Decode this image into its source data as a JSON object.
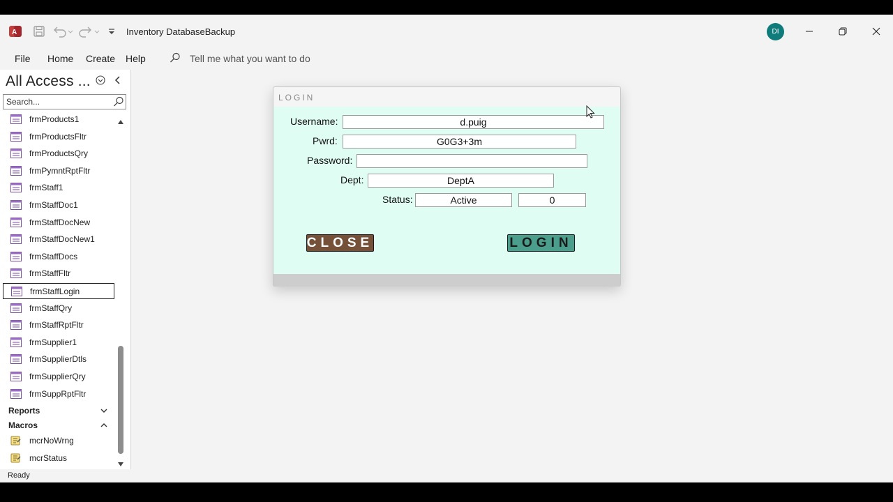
{
  "window": {
    "title": "Inventory DatabaseBackup",
    "avatar_initials": "DI",
    "accent": "#0f7b7b",
    "app_brand_color": "#c43e3e"
  },
  "menu": {
    "file": "File",
    "home": "Home",
    "create": "Create",
    "help": "Help",
    "tell_me": "Tell me what you want to do"
  },
  "nav": {
    "title": "All Access ...",
    "search_placeholder": "Search...",
    "items": [
      {
        "label": "frmProducts1",
        "icon": "form-icon"
      },
      {
        "label": "frmProductsFltr",
        "icon": "form-icon"
      },
      {
        "label": "frmProductsQry",
        "icon": "form-icon"
      },
      {
        "label": "frmPymntRptFltr",
        "icon": "form-icon"
      },
      {
        "label": "frmStaff1",
        "icon": "form-icon"
      },
      {
        "label": "frmStaffDoc1",
        "icon": "form-icon"
      },
      {
        "label": "frmStaffDocNew",
        "icon": "form-icon"
      },
      {
        "label": "frmStaffDocNew1",
        "icon": "form-icon"
      },
      {
        "label": "frmStaffDocs",
        "icon": "form-icon"
      },
      {
        "label": "frmStaffFltr",
        "icon": "form-icon"
      },
      {
        "label": "frmStaffLogin",
        "icon": "form-icon",
        "selected": true
      },
      {
        "label": "frmStaffQry",
        "icon": "form-icon"
      },
      {
        "label": "frmStaffRptFltr",
        "icon": "form-icon"
      },
      {
        "label": "frmSupplier1",
        "icon": "form-icon"
      },
      {
        "label": "frmSupplierDtls",
        "icon": "form-icon"
      },
      {
        "label": "frmSupplierQry",
        "icon": "form-icon"
      },
      {
        "label": "frmSuppRptFltr",
        "icon": "form-icon"
      }
    ],
    "groups": {
      "reports": "Reports",
      "macros": "Macros"
    },
    "macros": [
      {
        "label": "mcrNoWrng",
        "icon": "macro-icon"
      },
      {
        "label": "mcrStatus",
        "icon": "macro-icon"
      }
    ]
  },
  "login": {
    "title": "LOGIN",
    "username_label": "Username:",
    "username_value": "d.puig",
    "pwrd_label": "Pwrd:",
    "pwrd_value": "G0G3+3m",
    "password_label": "Password:",
    "password_value": "",
    "dept_label": "Dept:",
    "dept_value": "DeptA",
    "status_label": "Status:",
    "status_value": "Active",
    "count_value": "0",
    "close_label": "CLOSE",
    "login_label": "LOGIN",
    "body_color": "#e0fdf3",
    "close_color": "#75513a",
    "login_color": "#4a9e8b"
  },
  "status": {
    "text": "Ready"
  }
}
